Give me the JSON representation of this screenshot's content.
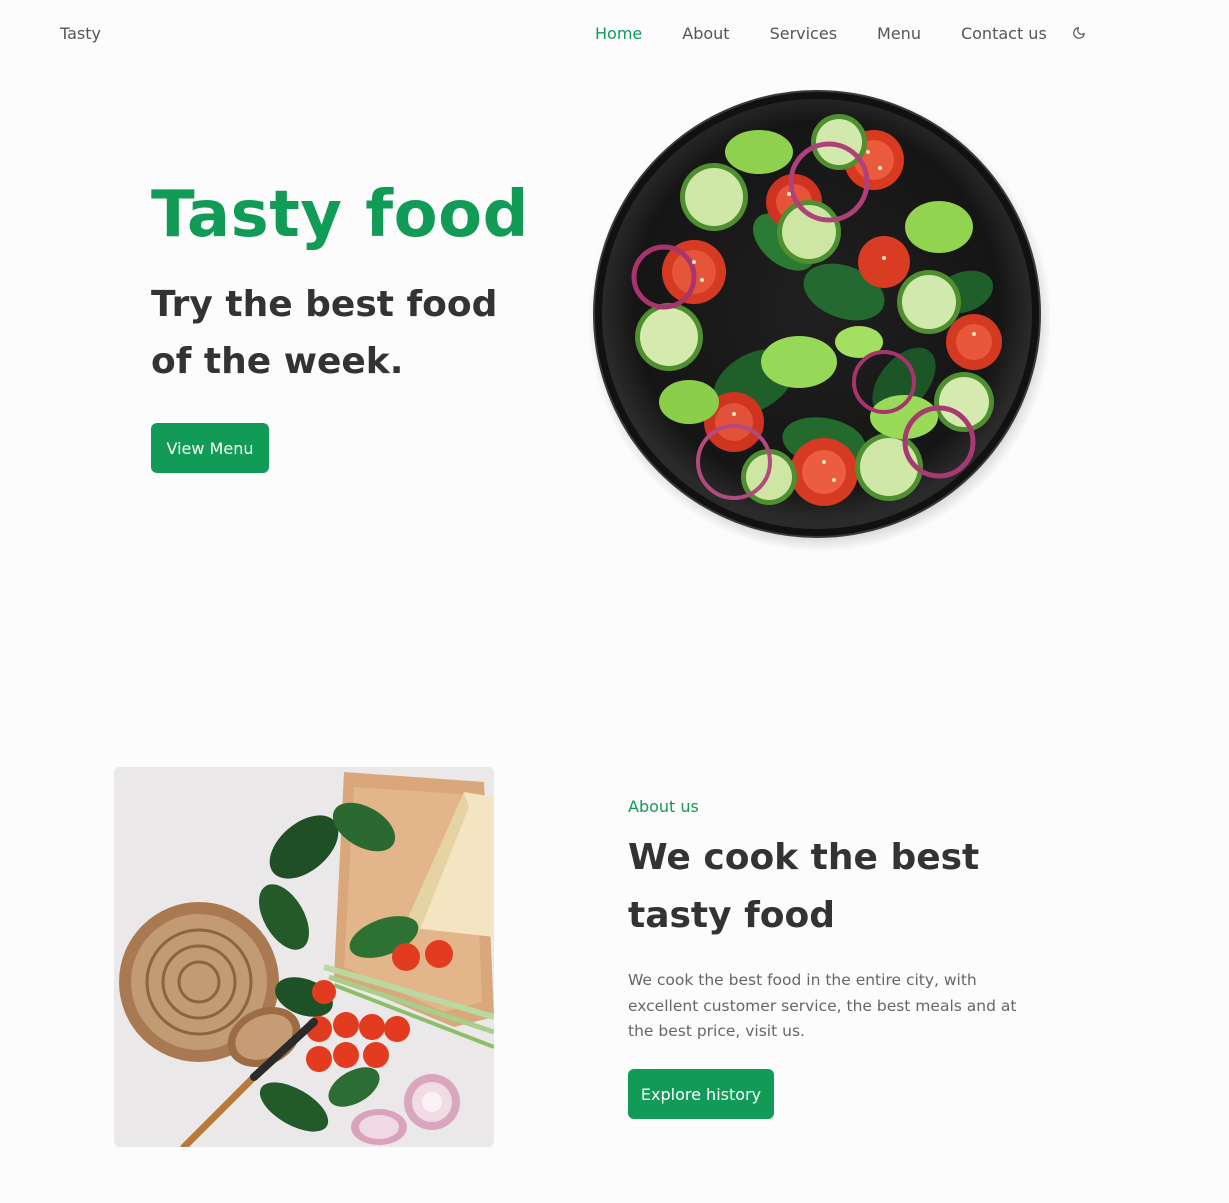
{
  "header": {
    "logo": "Tasty",
    "nav": [
      {
        "label": "Home",
        "active": true
      },
      {
        "label": "About",
        "active": false
      },
      {
        "label": "Services",
        "active": false
      },
      {
        "label": "Menu",
        "active": false
      },
      {
        "label": "Contact us",
        "active": false
      }
    ],
    "theme_icon": "moon-icon"
  },
  "hero": {
    "title": "Tasty food",
    "subtitle": "Try the best food of the week.",
    "button": "View Menu",
    "image_icon": "salad-plate-image"
  },
  "about": {
    "tag": "About us",
    "title": "We cook the best tasty food",
    "description": "We cook the best food in the entire city, with excellent customer service, the best meals and at the best price, visit us.",
    "button": "Explore history",
    "image_icon": "ingredients-image"
  },
  "colors": {
    "accent": "#129b57",
    "text": "#333333",
    "muted": "#666666",
    "background": "#fcfcfc"
  }
}
